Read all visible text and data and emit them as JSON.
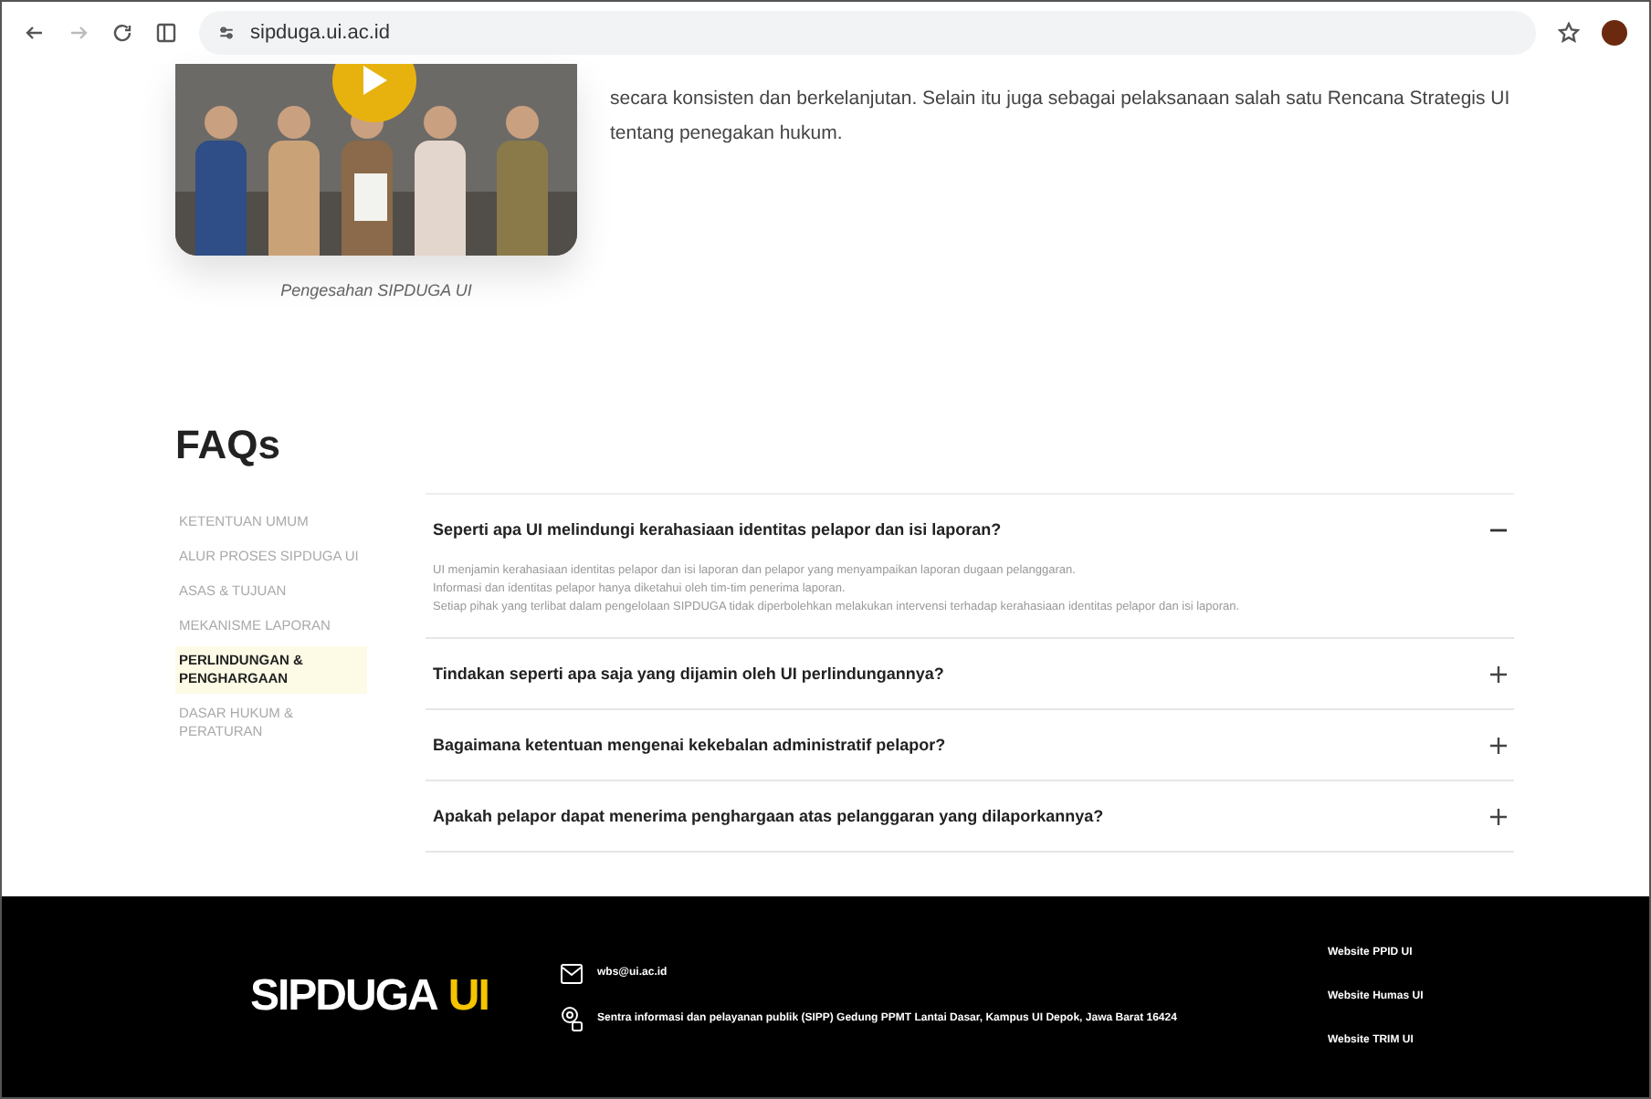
{
  "browser": {
    "url": "sipduga.ui.ac.id"
  },
  "intro": {
    "caption": "Pengesahan SIPDUGA UI",
    "paragraph": "secara konsisten dan berkelanjutan. Selain itu juga sebagai pelaksanaan salah satu Rencana Strategis UI tentang penegakan hukum."
  },
  "faq": {
    "title": "FAQs",
    "categories": [
      {
        "label": "KETENTUAN UMUM",
        "selected": false
      },
      {
        "label": "ALUR PROSES SIPDUGA UI",
        "selected": false
      },
      {
        "label": "ASAS & TUJUAN",
        "selected": false
      },
      {
        "label": "MEKANISME LAPORAN",
        "selected": false
      },
      {
        "label": "PERLINDUNGAN & PENGHARGAAN",
        "selected": true
      },
      {
        "label": "DASAR HUKUM & PERATURAN",
        "selected": false
      }
    ],
    "items": [
      {
        "question": "Seperti apa UI melindungi kerahasiaan identitas pelapor dan isi laporan?",
        "expanded": true,
        "answer": [
          "UI menjamin kerahasiaan identitas pelapor dan isi laporan dan pelapor yang menyampaikan laporan dugaan pelanggaran.",
          "Informasi dan identitas pelapor hanya diketahui oleh tim-tim penerima laporan.",
          "Setiap pihak yang terlibat dalam pengelolaan SIPDUGA tidak diperbolehkan melakukan intervensi terhadap kerahasiaan identitas pelapor dan isi laporan."
        ]
      },
      {
        "question": "Tindakan seperti apa saja yang dijamin oleh UI perlindungannya?",
        "expanded": false
      },
      {
        "question": "Bagaimana ketentuan mengenai kekebalan administratif pelapor?",
        "expanded": false
      },
      {
        "question": "Apakah pelapor dapat menerima penghargaan atas pelanggaran yang dilaporkannya?",
        "expanded": false
      }
    ]
  },
  "footer": {
    "logo": {
      "text": "SIPDUGA",
      "accent": "UI"
    },
    "email": "wbs@ui.ac.id",
    "address": "Sentra informasi dan pelayanan publik (SIPP) Gedung PPMT Lantai Dasar, Kampus UI Depok, Jawa Barat 16424",
    "links": [
      "Website PPID UI",
      "Website Humas UI",
      "Website TRIM UI"
    ]
  }
}
